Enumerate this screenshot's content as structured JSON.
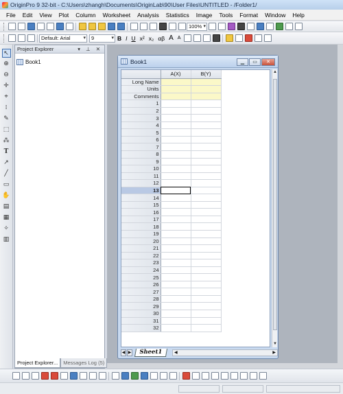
{
  "window": {
    "title": "OriginPro 9 32-bit - C:\\Users\\zhangh\\Documents\\OriginLab\\90\\User Files\\UNTITLED - /Folder1/"
  },
  "menu": [
    "File",
    "Edit",
    "View",
    "Plot",
    "Column",
    "Worksheet",
    "Analysis",
    "Statistics",
    "Image",
    "Tools",
    "Format",
    "Window",
    "Help"
  ],
  "toolbar": {
    "zoom": "100%",
    "font": "Default: Arial",
    "font_size": "9",
    "bold": "B",
    "italic": "I",
    "underline": "U",
    "superscript": "x²",
    "subscript": "x₂",
    "greek": "αβ",
    "increase_font": "A",
    "decrease_font": "A"
  },
  "explorer": {
    "title": "Project Explorer",
    "controls": "▾ ⊥ ✕",
    "items": [
      "Book1"
    ],
    "tabs": [
      "Project Explorer...",
      "Messages Log (5)"
    ]
  },
  "book": {
    "title": "Book1",
    "columns": [
      "A(X)",
      "B(Y)"
    ],
    "label_rows": [
      "Long Name",
      "Units",
      "Comments"
    ],
    "rows": [
      "1",
      "2",
      "3",
      "4",
      "5",
      "6",
      "7",
      "8",
      "9",
      "10",
      "11",
      "12",
      "13",
      "14",
      "15",
      "16",
      "17",
      "18",
      "19",
      "20",
      "21",
      "22",
      "23",
      "24",
      "25",
      "26",
      "27",
      "28",
      "29",
      "30",
      "31",
      "32"
    ],
    "active_row": "13",
    "sheet_tab": "Sheet1"
  },
  "colors": {
    "accent": "#3b6cae",
    "label_rows": "#fbf8c8",
    "selected_row": "#b9c9e4"
  }
}
